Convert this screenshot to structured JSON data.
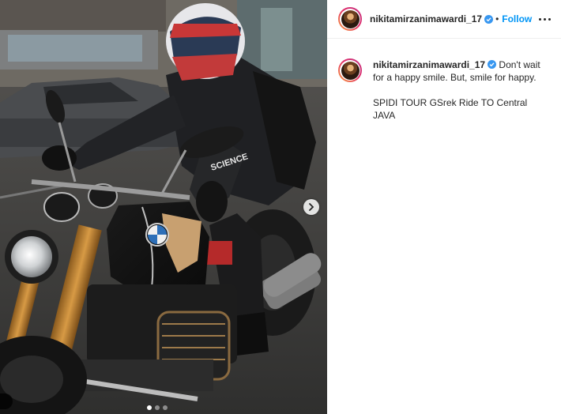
{
  "post": {
    "username": "nikitamirzanimawardi_17",
    "separator": "•",
    "follow_label": "Follow",
    "caption_line1": "Don't wait for a happy smile. But, smile for happy.",
    "caption_line2": "SPIDI TOUR GSrek Ride TO Central JAVA",
    "carousel": {
      "total_slides": 3,
      "active_slide": 1
    }
  },
  "photo": {
    "jacket_logo": "SCIENCE",
    "badge_text": "B"
  },
  "icons": {
    "verified": "verified-badge-icon",
    "more": "more-options-icon",
    "next": "chevron-right-icon"
  },
  "colors": {
    "link_blue": "#0095f6",
    "verified_blue": "#3897f0",
    "text": "#262626"
  }
}
